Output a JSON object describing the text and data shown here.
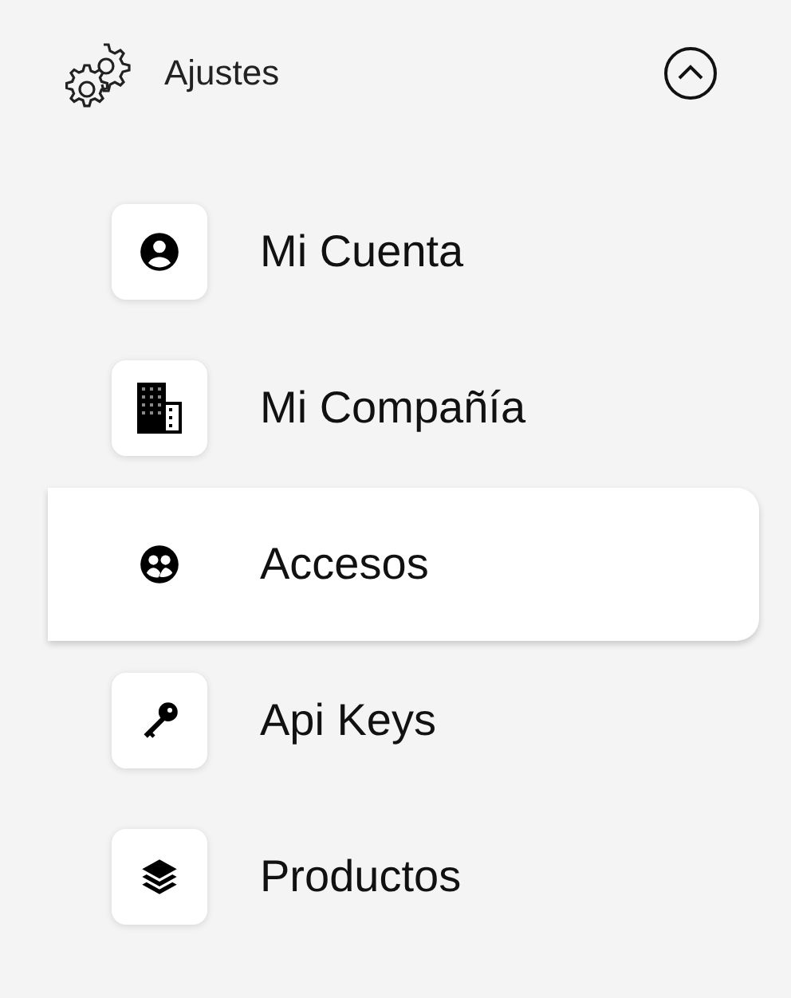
{
  "header": {
    "title": "Ajustes",
    "expanded": true
  },
  "items": [
    {
      "label": "Mi Cuenta",
      "kind": "account",
      "selected": false
    },
    {
      "label": "Mi Compañía",
      "kind": "company",
      "selected": false
    },
    {
      "label": "Accesos",
      "kind": "access",
      "selected": true
    },
    {
      "label": "Api Keys",
      "kind": "key",
      "selected": false
    },
    {
      "label": "Productos",
      "kind": "products",
      "selected": false
    }
  ]
}
